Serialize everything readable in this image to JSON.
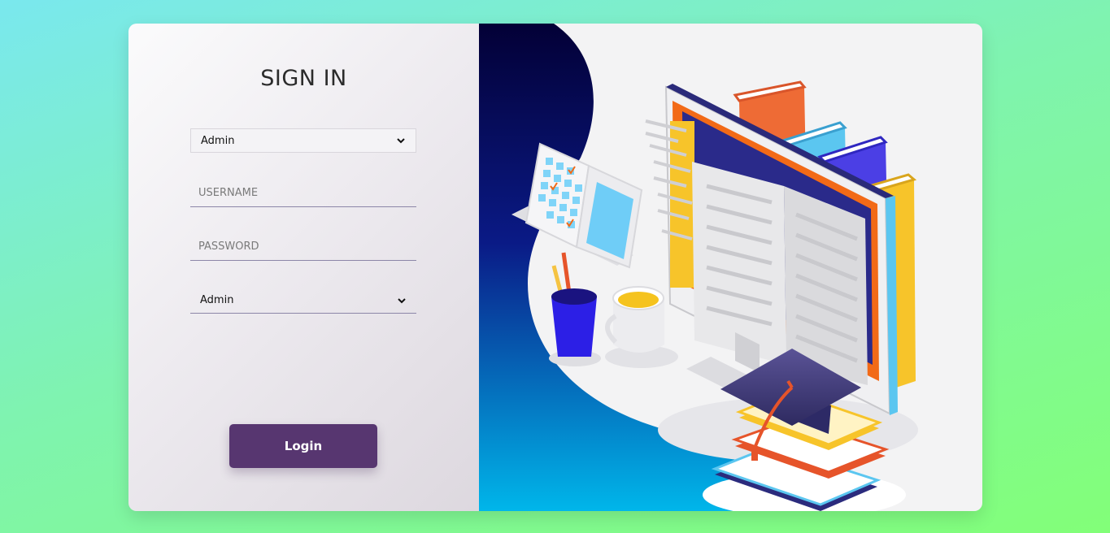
{
  "form": {
    "title": "SIGN IN",
    "top_select": {
      "value": "Admin"
    },
    "username": {
      "placeholder": "USERNAME"
    },
    "password": {
      "placeholder": "PASSWORD"
    },
    "bottom_select": {
      "value": "Admin"
    },
    "login_label": "Login"
  },
  "colors": {
    "button": "#573670",
    "underline": "#8c86a8",
    "wave_dark": "#030036",
    "wave_light": "#00b6ea"
  },
  "icons": [
    "chevron-down-icon",
    "chevron-down-icon"
  ]
}
